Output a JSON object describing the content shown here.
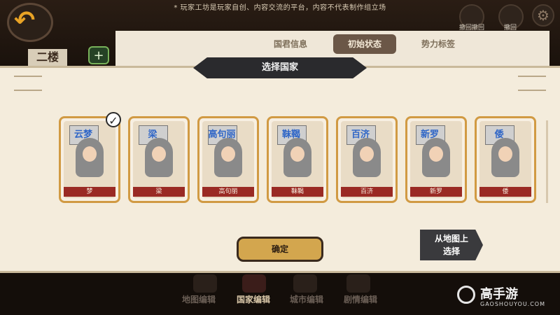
{
  "header": {
    "disclaimer": "* 玩家工坊是玩家自创、内容交流的平台，内容不代表制作组立场",
    "faction_tab": "二楼",
    "top_right": {
      "undo_all": "撤回撤回",
      "undo": "撤回"
    }
  },
  "tabs": [
    {
      "label": "国君信息"
    },
    {
      "label": "初始状态"
    },
    {
      "label": "势力标签"
    }
  ],
  "panel": {
    "title": "选择国家"
  },
  "countries": [
    {
      "flag": "云梦",
      "name": "梦"
    },
    {
      "flag": "梁",
      "name": "梁"
    },
    {
      "flag": "高句丽",
      "name": "高句丽"
    },
    {
      "flag": "靺鞨",
      "name": "靺鞨"
    },
    {
      "flag": "百济",
      "name": "百济"
    },
    {
      "flag": "新罗",
      "name": "新罗"
    },
    {
      "flag": "倭",
      "name": "倭"
    }
  ],
  "buttons": {
    "confirm": "确定",
    "select_from_map": "从地图上\n选择"
  },
  "bottom_nav": [
    {
      "label": "地图编辑"
    },
    {
      "label": "国家编辑"
    },
    {
      "label": "城市编辑"
    },
    {
      "label": "剧情编辑"
    }
  ],
  "watermark": {
    "name": "高手游",
    "sub": "GAOSHOUYOU.COM"
  },
  "colors": {
    "accent_gold": "#d3a64e",
    "panel_bg": "#f4ecdc",
    "dark_banner": "#2a2a2d",
    "name_bar_red": "#9a2a24",
    "flag_text_blue": "#2f66c7"
  },
  "icons": {
    "back": "back-arrow-icon",
    "undo_all": "undo-all-icon",
    "undo": "undo-icon",
    "settings": "gear-icon",
    "selected": "check-icon"
  }
}
